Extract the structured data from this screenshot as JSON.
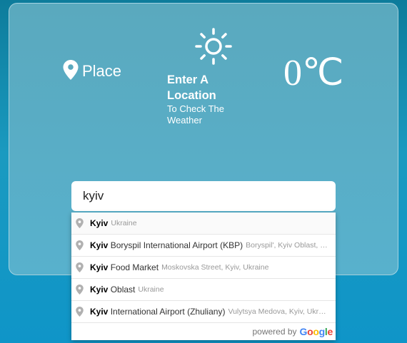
{
  "header": {
    "place_label": "Place",
    "prompt_title": "Enter A Location",
    "prompt_subtitle": "To Check The Weather",
    "temperature": "0℃"
  },
  "search": {
    "value": "kyiv"
  },
  "suggestions": [
    {
      "match": "Kyiv",
      "rest": "",
      "secondary": "Ukraine"
    },
    {
      "match": "Kyiv",
      "rest": " Boryspil International Airport (KBP)",
      "secondary": "Boryspil', Kyiv Oblast, Ukraine"
    },
    {
      "match": "Kyiv",
      "rest": " Food Market",
      "secondary": "Moskovska Street, Kyiv, Ukraine"
    },
    {
      "match": "Kyiv",
      "rest": " Oblast",
      "secondary": "Ukraine"
    },
    {
      "match": "Kyiv",
      "rest": " International Airport (Zhuliany)",
      "secondary": "Vulytsya Medova, Kyiv, Ukraine"
    }
  ],
  "powered_by": {
    "prefix": "powered by",
    "brand_letters": [
      "G",
      "o",
      "o",
      "g",
      "l",
      "e"
    ],
    "brand_colors": [
      "#4285F4",
      "#EA4335",
      "#FBBC05",
      "#4285F4",
      "#34A853",
      "#EA4335"
    ]
  },
  "icons": {
    "place": "location-pin-icon",
    "weather": "sun-icon",
    "suggestion": "map-marker-icon"
  },
  "colors": {
    "background": "#1595c0",
    "card": "#58adc6",
    "text": "#ffffff",
    "secondary_text": "#999999"
  }
}
